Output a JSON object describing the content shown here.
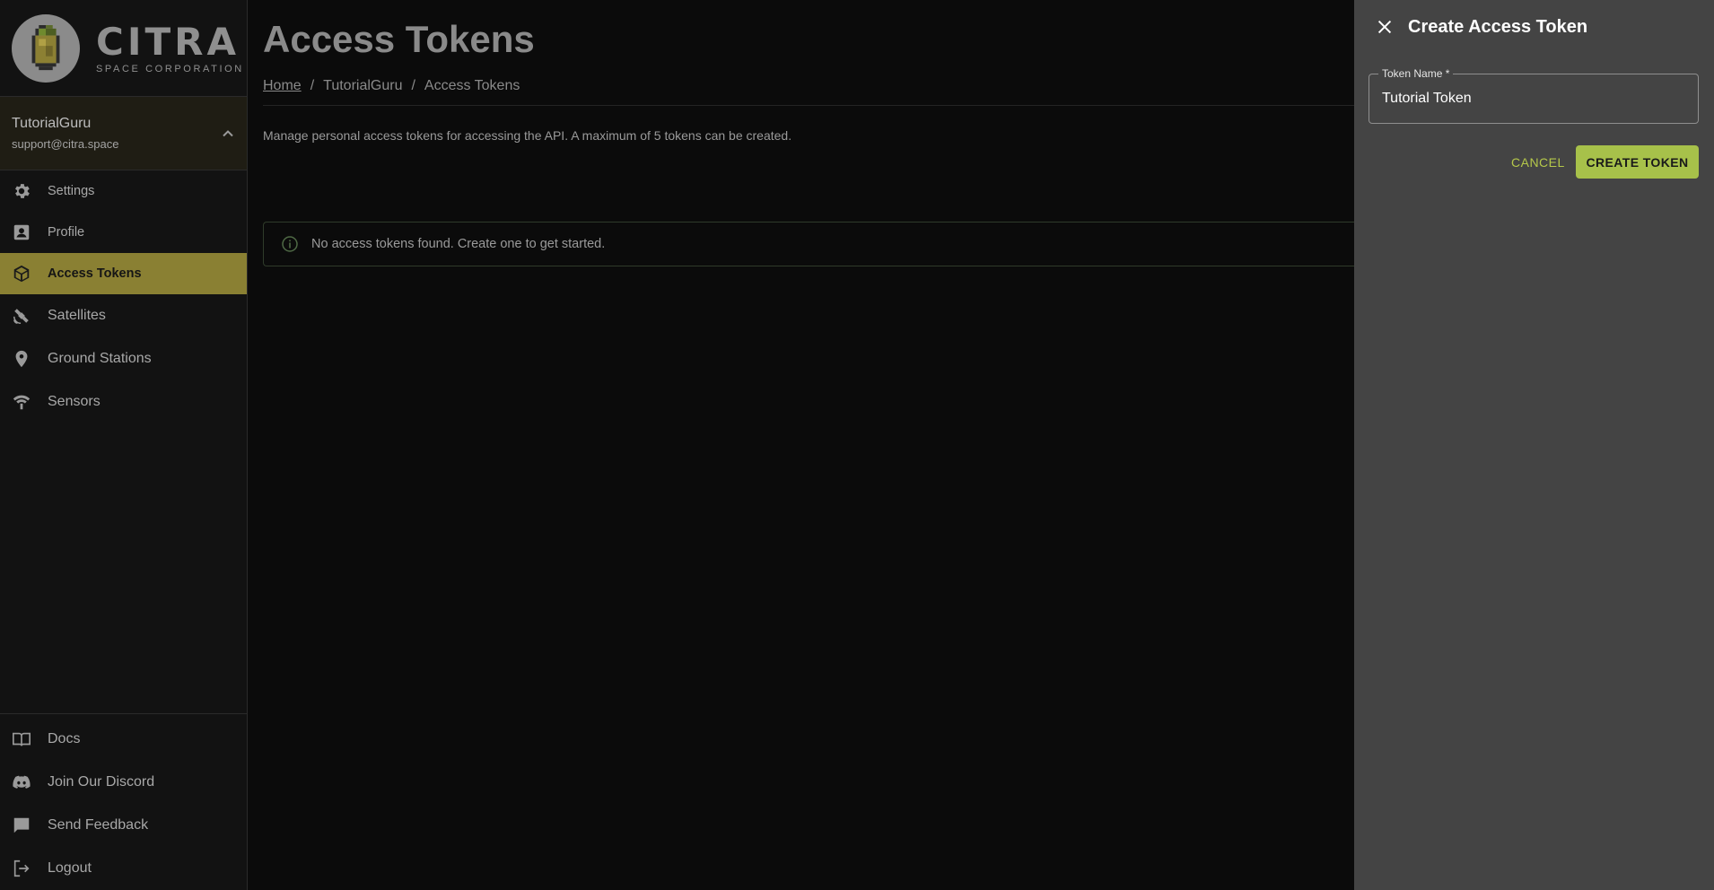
{
  "brand": {
    "word": "CITRA",
    "sub": "SPACE CORPORATION"
  },
  "user": {
    "name": "TutorialGuru",
    "email": "support@citra.space"
  },
  "sidebar": {
    "items": [
      {
        "label": "Settings",
        "icon": "gear-icon"
      },
      {
        "label": "Profile",
        "icon": "profile-icon"
      },
      {
        "label": "Access Tokens",
        "icon": "token-icon",
        "active": true
      },
      {
        "label": "Satellites",
        "icon": "satellite-icon"
      },
      {
        "label": "Ground Stations",
        "icon": "location-pin-icon"
      },
      {
        "label": "Sensors",
        "icon": "sensor-icon"
      }
    ],
    "bottom": [
      {
        "label": "Docs",
        "icon": "book-icon"
      },
      {
        "label": "Join Our Discord",
        "icon": "discord-icon"
      },
      {
        "label": "Send Feedback",
        "icon": "feedback-icon"
      },
      {
        "label": "Logout",
        "icon": "logout-icon"
      }
    ]
  },
  "main": {
    "title": "Access Tokens",
    "breadcrumb": [
      "Home",
      "TutorialGuru",
      "Access Tokens"
    ],
    "description": "Manage personal access tokens for accessing the API. A maximum of 5 tokens can be created.",
    "alert": "No access tokens found. Create one to get started."
  },
  "drawer": {
    "title": "Create Access Token",
    "field_label": "Token Name",
    "field_required": "*",
    "field_value": "Tutorial Token",
    "cancel_label": "CANCEL",
    "create_label": "CREATE TOKEN"
  },
  "colors": {
    "accent": "#a7c14a",
    "active_nav": "#8a8033",
    "drawer_bg": "#444444"
  }
}
